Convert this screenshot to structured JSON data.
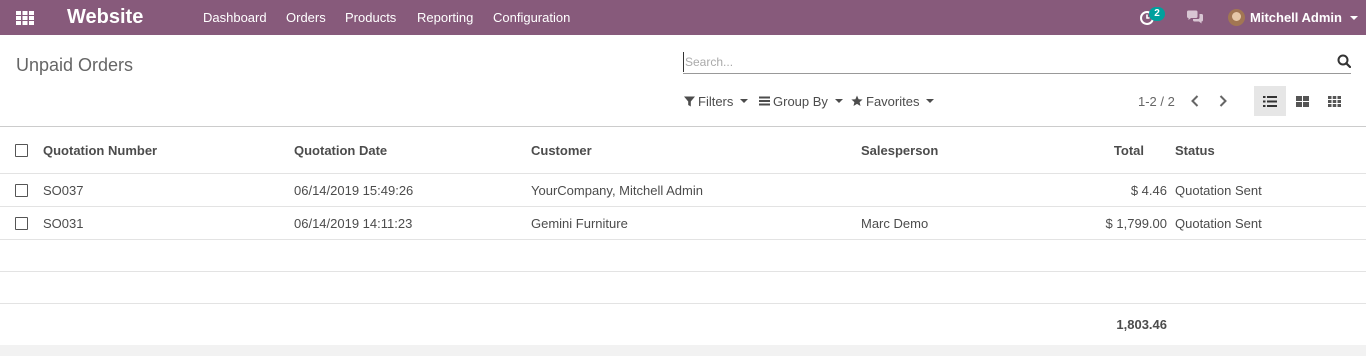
{
  "navbar": {
    "brand": "Website",
    "menu": [
      "Dashboard",
      "Orders",
      "Products",
      "Reporting",
      "Configuration"
    ],
    "activity_badge": "2",
    "user_name": "Mitchell Admin"
  },
  "control_panel": {
    "title": "Unpaid Orders",
    "search_placeholder": "Search...",
    "filters_label": "Filters",
    "group_by_label": "Group By",
    "favorites_label": "Favorites",
    "pager": "1-2 / 2"
  },
  "list": {
    "columns": [
      "Quotation Number",
      "Quotation Date",
      "Customer",
      "Salesperson",
      "Total",
      "Status"
    ],
    "rows": [
      [
        "SO037",
        "06/14/2019 15:49:26",
        "YourCompany, Mitchell Admin",
        "",
        "$ 4.46",
        "Quotation Sent"
      ],
      [
        "SO031",
        "06/14/2019 14:11:23",
        "Gemini Furniture",
        "Marc Demo",
        "$ 1,799.00",
        "Quotation Sent"
      ]
    ],
    "footer_total": "1,803.46"
  },
  "colors": {
    "navbar": "#875a7b",
    "badge": "#00a09d"
  },
  "icons": [
    "apps-icon",
    "activity-clock-icon",
    "chat-icon",
    "search-icon",
    "filter-icon",
    "group-by-icon",
    "star-icon",
    "chevron-left-icon",
    "chevron-right-icon",
    "list-view-icon",
    "kanban-view-icon",
    "grid-view-icon"
  ]
}
